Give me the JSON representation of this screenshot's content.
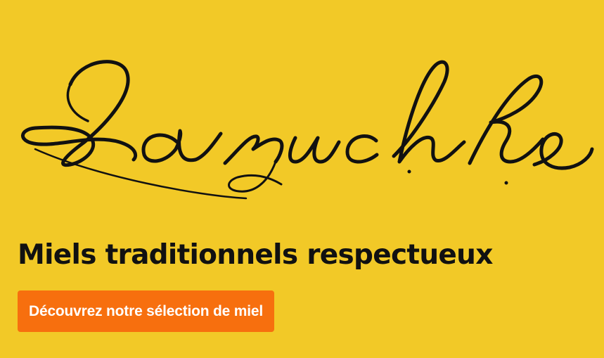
{
  "brand": {
    "name": "La ruche"
  },
  "hero": {
    "tagline": "Miels traditionnels respectueux",
    "cta_label": "Découvrez notre sélection de miel"
  },
  "colors": {
    "background": "#F2C927",
    "text": "#111111",
    "cta_background": "#F76F0E",
    "cta_text": "#FFFFFF"
  },
  "icons": {
    "logo": "script-wordmark-logo"
  }
}
